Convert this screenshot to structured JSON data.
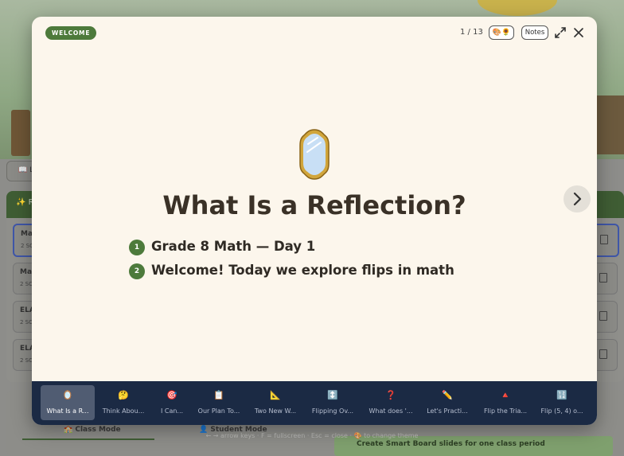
{
  "background": {
    "tab_label": "📖 Le",
    "panel_header": "✨ Re",
    "rows": [
      {
        "title": "Ma",
        "sub": "2 SC"
      },
      {
        "title": "Ma",
        "sub": "2 SC"
      },
      {
        "title": "ELA",
        "sub": "2 SC"
      },
      {
        "title": "ELA",
        "sub": "2 SC"
      }
    ],
    "class_mode": "🏫 Class Mode",
    "student_mode": "👤 Student Mode",
    "smart_board_button": "Create Smart Board slides for one class period",
    "keyboard_hint": "← → arrow keys · F = fullscreen · Esc = close · 🎨 to change theme"
  },
  "modal": {
    "badge": "WELCOME",
    "counter": "1 / 13",
    "theme_button_icon": "🎨🌻",
    "notes_button": "Notes",
    "slide": {
      "icon": "mirror-icon",
      "title": "What Is a Reflection?",
      "points": [
        {
          "num": "1",
          "text": "Grade 8 Math — Day 1"
        },
        {
          "num": "2",
          "text": "Welcome! Today we explore flips in math"
        }
      ]
    },
    "thumbnails": [
      {
        "icon": "🪞",
        "label": "What Is a R...",
        "active": true
      },
      {
        "icon": "🤔",
        "label": "Think Abou...",
        "active": false
      },
      {
        "icon": "🎯",
        "label": "I Can...",
        "active": false
      },
      {
        "icon": "📋",
        "label": "Our Plan To...",
        "active": false
      },
      {
        "icon": "📐",
        "label": "Two New W...",
        "active": false
      },
      {
        "icon": "↕️",
        "label": "Flipping Ov...",
        "active": false
      },
      {
        "icon": "❓",
        "label": "What does '...",
        "active": false
      },
      {
        "icon": "✏️",
        "label": "Let's Practi...",
        "active": false
      },
      {
        "icon": "🔺",
        "label": "Flip the Tria...",
        "active": false
      },
      {
        "icon": "🔢",
        "label": "Flip (5, 4) o...",
        "active": false
      }
    ]
  },
  "colors": {
    "accent_green": "#4d7a3b",
    "strip_navy": "#1b2a44",
    "modal_bg": "#fcf6ec",
    "title_text": "#3a3127"
  }
}
